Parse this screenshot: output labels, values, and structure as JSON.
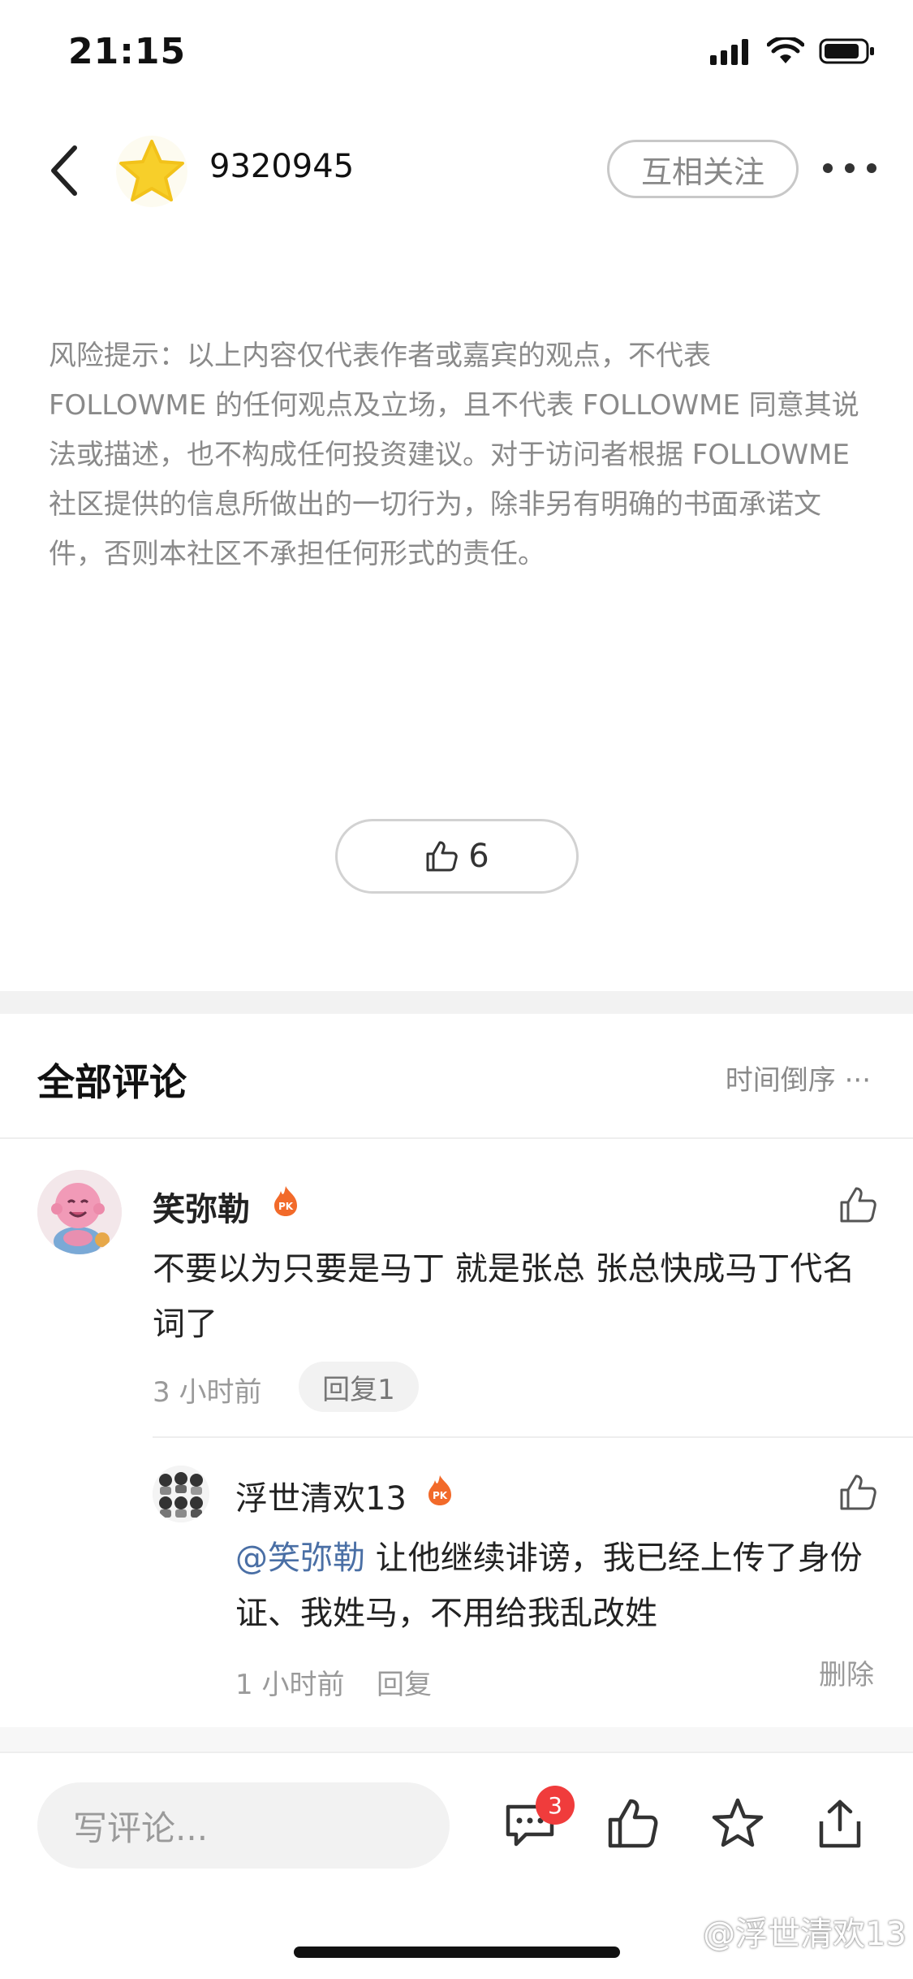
{
  "status_bar": {
    "time": "21:15"
  },
  "header": {
    "user_id": "9320945",
    "follow_label": "互相关注"
  },
  "disclaimer": "风险提示：以上内容仅代表作者或嘉宾的观点，不代表 FOLLOWME 的任何观点及立场，且不代表 FOLLOWME 同意其说法或描述，也不构成任何投资建议。对于访问者根据 FOLLOWME 社区提供的信息所做出的一切行为，除非另有明确的书面承诺文件，否则本社区不承担任何形式的责任。",
  "likes": {
    "count": "6"
  },
  "comments_section": {
    "title": "全部评论",
    "sort_label": "时间倒序 ···"
  },
  "comments": [
    {
      "author": "笑弥勒",
      "badge": "PK",
      "text": "不要以为只要是马丁 就是张总 张总快成马丁代名词了",
      "time": "3 小时前",
      "reply_label": "回复1"
    }
  ],
  "reply": {
    "author": "浮世清欢13",
    "badge": "PK",
    "mention": "@笑弥勒",
    "text": " 让他继续诽谤，我已经上传了身份证、我姓马，不用给我乱改姓",
    "time": "1 小时前",
    "reply_label": "回复",
    "delete_label": "删除"
  },
  "bottom_bar": {
    "input_placeholder": "写评论...",
    "comment_badge_count": "3"
  },
  "watermark": "@浮世清欢13",
  "colors": {
    "accent_red": "#f03c3c",
    "mention_blue": "#4a6fa5",
    "muted_text": "#8a8a8a",
    "star_yellow": "#f7cf2a"
  },
  "icons": [
    "back-arrow-icon",
    "star-avatar-icon",
    "more-dots-icon",
    "thumbs-up-icon",
    "fire-badge-icon",
    "comment-icon",
    "star-icon",
    "share-icon"
  ]
}
